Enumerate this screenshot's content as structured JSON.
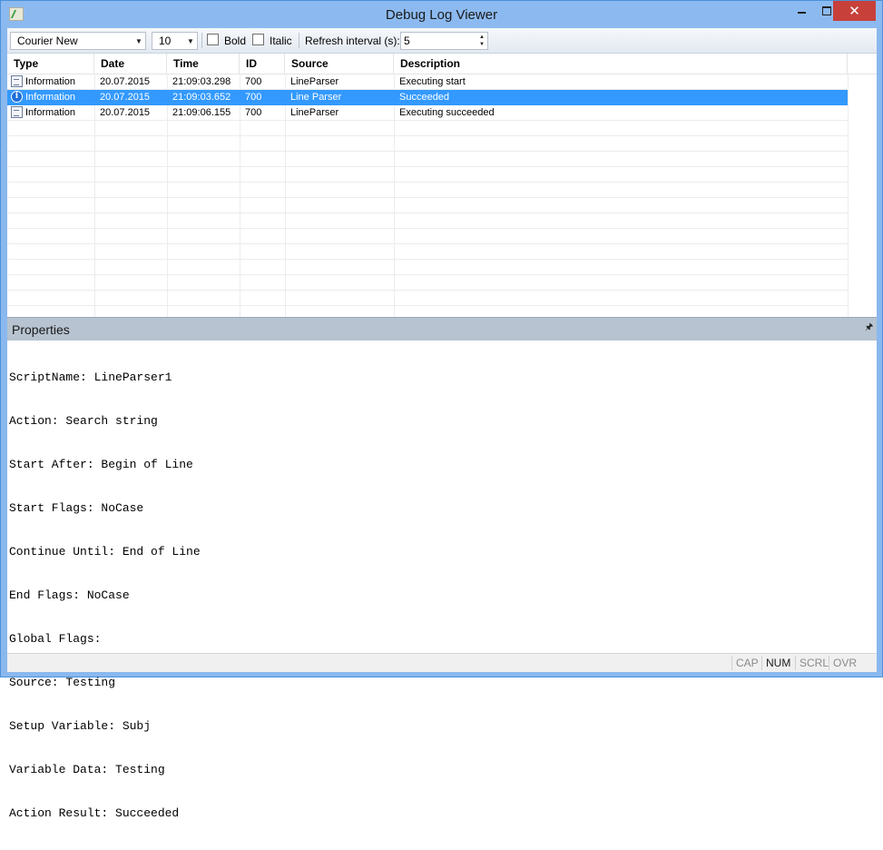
{
  "window": {
    "title": "Debug Log Viewer",
    "close_glyph": "✕"
  },
  "toolbar": {
    "font_value": "Courier New",
    "size_value": "10",
    "bold_label": "Bold",
    "italic_label": "Italic",
    "refresh_label": "Refresh interval (s):",
    "refresh_value": "5",
    "bold_checked": false,
    "italic_checked": false
  },
  "log": {
    "columns": [
      "Type",
      "Date",
      "Time",
      "ID",
      "Source",
      "Description"
    ],
    "rows": [
      {
        "type": "Information",
        "date": "20.07.2015",
        "time": "21:09:03.298",
        "id": "700",
        "source": "LineParser",
        "description": "Executing start",
        "icon": "document-icon",
        "selected": false
      },
      {
        "type": "Information",
        "date": "20.07.2015",
        "time": "21:09:03.652",
        "id": "700",
        "source": "Line Parser",
        "description": "Succeeded",
        "icon": "info-icon",
        "selected": true
      },
      {
        "type": "Information",
        "date": "20.07.2015",
        "time": "21:09:06.155",
        "id": "700",
        "source": "LineParser",
        "description": "Executing succeeded",
        "icon": "document-icon",
        "selected": false
      }
    ]
  },
  "properties": {
    "title": "Properties",
    "lines": [
      "ScriptName: LineParser1",
      "Action: Search string",
      "Start After: Begin of Line",
      "Start Flags: NoCase",
      "Continue Until: End of Line",
      "End Flags: NoCase",
      "Global Flags:",
      "Source: Testing",
      "Setup Variable: Subj",
      "Variable Data: Testing",
      "Action Result: Succeeded"
    ]
  },
  "statusbar": {
    "cap": "CAP",
    "num": "NUM",
    "scrl": "SCRL",
    "ovr": "OVR"
  },
  "colors": {
    "selection": "#3399ff",
    "close_button": "#c7403a",
    "title_bar": "#8cbaf0"
  }
}
